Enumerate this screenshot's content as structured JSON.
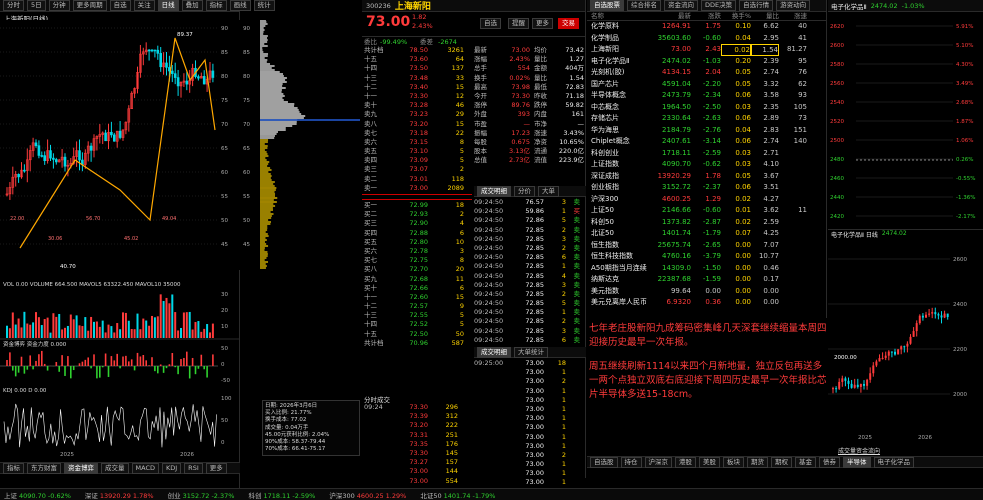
{
  "left_chart": {
    "toolbar_tabs": [
      "分时",
      "5日",
      "分钟",
      "更多周期",
      "自选",
      "关注",
      "日线",
      "叠加",
      "指标",
      "画线",
      "统计"
    ],
    "active_tab": "日线",
    "title": "上海新阳(日线)",
    "price_high": "89.37",
    "price_low": "40.70",
    "price_axis": [
      "90",
      "85",
      "80",
      "75",
      "70",
      "65",
      "60",
      "55",
      "50",
      "45"
    ],
    "hover_values": [
      "22.00",
      "30.06",
      "56.70",
      "45.02",
      "49.04"
    ],
    "vol_label": "VOL 0.00  VOLUME 664.500  MAVOL5 63322.450  MAVOL10 35000",
    "vol_axis": [
      "30",
      "20",
      "10"
    ],
    "macd_label": "资金博弈 资金力度 0.000",
    "macd_axis": [
      "50",
      "0",
      "-50"
    ],
    "kdj_label": "KDJ 0.00  D 0.00",
    "kdj_axis": [
      "100",
      "50",
      "0"
    ],
    "x_labels": [
      "2025",
      "2026"
    ],
    "bottom_tabs": [
      "指标",
      "东方财富",
      "资金博弈",
      "成交量",
      "MACD",
      "KDJ",
      "RSI",
      "更多"
    ],
    "active_bottom_tab": "资金博弈"
  },
  "quote": {
    "code": "300236",
    "name": "上海新阳",
    "price": "73.00",
    "change": "1.82",
    "change_pct": "2.43%",
    "buttons": [
      "自选",
      "提醒",
      "更多",
      "交易"
    ],
    "ratio_label": "委比",
    "ratio_value": "-99.49%",
    "diff_label": "委差",
    "diff_value": "-2674",
    "open_auction": "开盘竞价",
    "sells": [
      {
        "label": "十五",
        "price": "73.60",
        "vol": "64"
      },
      {
        "label": "十四",
        "price": "73.50",
        "vol": "137"
      },
      {
        "label": "十三",
        "price": "73.48",
        "vol": "33"
      },
      {
        "label": "十二",
        "price": "73.40",
        "vol": "15"
      },
      {
        "label": "十一",
        "price": "73.30",
        "vol": "12"
      },
      {
        "label": "卖十",
        "price": "73.28",
        "vol": "46"
      },
      {
        "label": "卖九",
        "price": "73.23",
        "vol": "29"
      },
      {
        "label": "卖八",
        "price": "73.20",
        "vol": "15"
      },
      {
        "label": "卖七",
        "price": "73.18",
        "vol": "22"
      },
      {
        "label": "卖六",
        "price": "73.15",
        "vol": "8"
      },
      {
        "label": "卖五",
        "price": "73.10",
        "vol": "5"
      },
      {
        "label": "卖四",
        "price": "73.09",
        "vol": "5"
      },
      {
        "label": "卖三",
        "price": "73.07",
        "vol": "2"
      },
      {
        "label": "卖二",
        "price": "73.01",
        "vol": "118"
      },
      {
        "label": "卖一",
        "price": "73.00",
        "vol": "2089"
      }
    ],
    "sell_total": {
      "label": "共计档",
      "price": "78.50",
      "vol": "3261"
    },
    "buys": [
      {
        "label": "买一",
        "price": "72.99",
        "vol": "18"
      },
      {
        "label": "买二",
        "price": "72.93",
        "vol": "2"
      },
      {
        "label": "买三",
        "price": "72.90",
        "vol": "4"
      },
      {
        "label": "买四",
        "price": "72.88",
        "vol": "6"
      },
      {
        "label": "买五",
        "price": "72.80",
        "vol": "10"
      },
      {
        "label": "买六",
        "price": "72.78",
        "vol": "3"
      },
      {
        "label": "买七",
        "price": "72.75",
        "vol": "8"
      },
      {
        "label": "买八",
        "price": "72.70",
        "vol": "20"
      },
      {
        "label": "买九",
        "price": "72.68",
        "vol": "11"
      },
      {
        "label": "买十",
        "price": "72.66",
        "vol": "6"
      },
      {
        "label": "十一",
        "price": "72.60",
        "vol": "15"
      },
      {
        "label": "十二",
        "price": "72.57",
        "vol": "9"
      },
      {
        "label": "十三",
        "price": "72.55",
        "vol": "5"
      },
      {
        "label": "十四",
        "price": "72.52",
        "vol": "5"
      },
      {
        "label": "十五",
        "price": "72.50",
        "vol": "50"
      }
    ],
    "buy_total": {
      "label": "共计档",
      "price": "70.96",
      "vol": "587"
    },
    "stats": [
      {
        "k": "最新",
        "v": "73.00",
        "k2": "均价",
        "v2": "73.42"
      },
      {
        "k": "涨幅",
        "v": "2.43%",
        "k2": "量比",
        "v2": "1.27"
      },
      {
        "k": "总手",
        "v": "554",
        "k2": "金额",
        "v2": "404万"
      },
      {
        "k": "换手",
        "v": "0.02%",
        "k2": "量比",
        "v2": "1.54"
      },
      {
        "k": "最高",
        "v": "73.98",
        "k2": "最低",
        "v2": "72.83"
      },
      {
        "k": "今开",
        "v": "73.30",
        "k2": "昨收",
        "v2": "71.18"
      },
      {
        "k": "涨停",
        "v": "89.76",
        "k2": "跌停",
        "v2": "59.82"
      },
      {
        "k": "外盘",
        "v": "393",
        "k2": "内盘",
        "v2": "161"
      },
      {
        "k": "市盈",
        "v": "—",
        "k2": "市净",
        "v2": "—"
      },
      {
        "k": "振幅",
        "v": "17.23",
        "k2": "涨速",
        "v2": "3.43%"
      },
      {
        "k": "每股",
        "v": "0.675",
        "k2": "净资",
        "v2": "10.65%"
      },
      {
        "k": "股本",
        "v": "3.13亿",
        "k2": "流通",
        "v2": "220.0亿"
      },
      {
        "k": "总值",
        "v": "2.73亿",
        "k2": "流值",
        "v2": "223.9亿"
      }
    ],
    "trades_tabs": [
      "成交明细",
      "分价",
      "大单"
    ],
    "trades": [
      {
        "t": "09:24:50",
        "p": "76.57",
        "v": "3",
        "d": "卖"
      },
      {
        "t": "09:24:50",
        "p": "59.86",
        "v": "1",
        "d": "买"
      },
      {
        "t": "09:24:50",
        "p": "72.86",
        "v": "5",
        "d": "卖"
      },
      {
        "t": "09:24:50",
        "p": "72.85",
        "v": "2",
        "d": "卖"
      },
      {
        "t": "09:24:50",
        "p": "72.85",
        "v": "3",
        "d": "卖"
      },
      {
        "t": "09:24:50",
        "p": "72.85",
        "v": "2",
        "d": "卖"
      },
      {
        "t": "09:24:50",
        "p": "72.85",
        "v": "6",
        "d": "卖"
      },
      {
        "t": "09:24:50",
        "p": "72.85",
        "v": "1",
        "d": "卖"
      },
      {
        "t": "09:24:50",
        "p": "72.85",
        "v": "4",
        "d": "卖"
      },
      {
        "t": "09:24:50",
        "p": "72.85",
        "v": "3",
        "d": "卖"
      },
      {
        "t": "09:24:50",
        "p": "72.85",
        "v": "2",
        "d": "卖"
      },
      {
        "t": "09:24:50",
        "p": "72.85",
        "v": "5",
        "d": "卖"
      },
      {
        "t": "09:24:50",
        "p": "72.85",
        "v": "1",
        "d": "卖"
      },
      {
        "t": "09:24:50",
        "p": "72.85",
        "v": "2",
        "d": "卖"
      },
      {
        "t": "09:24:50",
        "p": "72.85",
        "v": "3",
        "d": "卖"
      },
      {
        "t": "09:24:50",
        "p": "72.85",
        "v": "6",
        "d": "卖"
      },
      {
        "t": "09:24:50",
        "p": "72.85",
        "v": "1",
        "d": "卖"
      },
      {
        "t": "09:24:50",
        "p": "72.85",
        "v": "2",
        "d": "卖"
      },
      {
        "t": "09:24:50",
        "p": "72.85",
        "v": "4",
        "d": "卖"
      },
      {
        "t": "09:24:50",
        "p": "72.85",
        "v": "8",
        "d": "卖"
      }
    ],
    "lower_tabs": [
      "成交明细",
      "大单统计"
    ],
    "lower_trades": [
      {
        "t": "09:25:00",
        "p": "73.00",
        "v": "18"
      },
      {
        "t": "",
        "p": "73.00",
        "v": "1"
      },
      {
        "t": "",
        "p": "73.00",
        "v": "2"
      },
      {
        "t": "",
        "p": "73.00",
        "v": "1"
      },
      {
        "t": "",
        "p": "73.00",
        "v": "1"
      },
      {
        "t": "",
        "p": "73.00",
        "v": "1"
      },
      {
        "t": "",
        "p": "73.00",
        "v": "1"
      },
      {
        "t": "",
        "p": "73.00",
        "v": "1"
      },
      {
        "t": "",
        "p": "73.00",
        "v": "1"
      },
      {
        "t": "",
        "p": "73.00",
        "v": "1"
      },
      {
        "t": "",
        "p": "73.00",
        "v": "2"
      },
      {
        "t": "",
        "p": "73.00",
        "v": "1"
      },
      {
        "t": "",
        "p": "73.00",
        "v": "1"
      },
      {
        "t": "",
        "p": "73.00",
        "v": "1"
      },
      {
        "t": "",
        "p": "73.00",
        "v": "1"
      }
    ],
    "minute_header": "分时成交",
    "minute_trades": [
      {
        "t": "09:24",
        "p": "73.30",
        "v": "296"
      },
      {
        "t": "",
        "p": "73.39",
        "v": "312"
      },
      {
        "t": "",
        "p": "73.20",
        "v": "222"
      },
      {
        "t": "",
        "p": "73.31",
        "v": "251"
      },
      {
        "t": "",
        "p": "73.35",
        "v": "176"
      },
      {
        "t": "",
        "p": "73.30",
        "v": "145"
      },
      {
        "t": "",
        "p": "73.27",
        "v": "157"
      },
      {
        "t": "",
        "p": "73.00",
        "v": "144"
      },
      {
        "t": "",
        "p": "73.00",
        "v": "554"
      }
    ],
    "info_lines": [
      "日期: 2026年3月6日",
      "买入比例: 21.77%",
      "换手成本: 77.02",
      "成交量: 0.04万手",
      "45.00元获利比例: 2.04%",
      "90%成本: 58.37-79.44",
      "70%成本: 66.41-75.17"
    ]
  },
  "watchlist": {
    "tabs": [
      "自选股票",
      "综合排名",
      "资金流向",
      "DDE决策",
      "自选行情",
      "游资动向"
    ],
    "headers": [
      "名称",
      "最新",
      "涨跌",
      "换手%",
      "量比",
      "涨速"
    ],
    "rows": [
      {
        "n": "化学原料",
        "p": "1264.91",
        "c": "1.75",
        "t": "0.10",
        "r": "6.62",
        "s": "40"
      },
      {
        "n": "化学制品",
        "p": "35603.60",
        "c": "-0.60",
        "t": "0.04",
        "r": "2.95",
        "s": "41"
      },
      {
        "n": "上海新阳",
        "p": "73.00",
        "c": "2.43",
        "t": "0.02",
        "r": "1.54",
        "s": "81.27"
      },
      {
        "n": "电子化学品Ⅱ",
        "p": "2474.02",
        "c": "-1.03",
        "t": "0.20",
        "r": "2.39",
        "s": "95"
      },
      {
        "n": "光刻机(胶)",
        "p": "4134.15",
        "c": "2.04",
        "t": "0.05",
        "r": "2.74",
        "s": "76"
      },
      {
        "n": "国产芯片",
        "p": "4591.04",
        "c": "-2.20",
        "t": "0.05",
        "r": "3.32",
        "s": "62"
      },
      {
        "n": "半导体概念",
        "p": "2473.79",
        "c": "-2.34",
        "t": "0.06",
        "r": "3.58",
        "s": "93"
      },
      {
        "n": "中芯概念",
        "p": "1964.50",
        "c": "-2.50",
        "t": "0.03",
        "r": "2.35",
        "s": "105"
      },
      {
        "n": "存储芯片",
        "p": "2330.64",
        "c": "-2.63",
        "t": "0.06",
        "r": "2.89",
        "s": "73"
      },
      {
        "n": "华为海思",
        "p": "2184.79",
        "c": "-2.76",
        "t": "0.04",
        "r": "2.83",
        "s": "151"
      },
      {
        "n": "Chiplet概念",
        "p": "2407.61",
        "c": "-3.14",
        "t": "0.06",
        "r": "2.74",
        "s": "140"
      },
      {
        "n": "科创创业",
        "p": "1718.11",
        "c": "-2.59",
        "t": "0.03",
        "r": "2.71",
        "s": ""
      },
      {
        "n": "上证指数",
        "p": "4090.70",
        "c": "-0.62",
        "t": "0.03",
        "r": "4.10",
        "s": ""
      },
      {
        "n": "深证成指",
        "p": "13920.29",
        "c": "1.78",
        "t": "0.05",
        "r": "3.67",
        "s": ""
      },
      {
        "n": "创业板指",
        "p": "3152.72",
        "c": "-2.37",
        "t": "0.06",
        "r": "3.51",
        "s": ""
      },
      {
        "n": "沪深300",
        "p": "4600.25",
        "c": "1.29",
        "t": "0.02",
        "r": "4.27",
        "s": ""
      },
      {
        "n": "上证50",
        "p": "2146.66",
        "c": "-0.60",
        "t": "0.01",
        "r": "3.62",
        "s": "11"
      },
      {
        "n": "科创50",
        "p": "1373.82",
        "c": "-2.87",
        "t": "0.02",
        "r": "2.59",
        "s": ""
      },
      {
        "n": "北证50",
        "p": "1401.74",
        "c": "-1.79",
        "t": "0.07",
        "r": "4.25",
        "s": ""
      },
      {
        "n": "恒生指数",
        "p": "25675.74",
        "c": "-2.65",
        "t": "0.00",
        "r": "7.07",
        "s": ""
      },
      {
        "n": "恒生科技指数",
        "p": "4760.16",
        "c": "-3.79",
        "t": "0.00",
        "r": "10.77",
        "s": ""
      },
      {
        "n": "A50期指当月连续",
        "p": "14309.0",
        "c": "-1.50",
        "t": "0.00",
        "r": "0.46",
        "s": ""
      },
      {
        "n": "纳斯达克",
        "p": "22387.68",
        "c": "-1.59",
        "t": "0.00",
        "r": "0.17",
        "s": ""
      },
      {
        "n": "美元指数",
        "p": "99.64",
        "c": "0.00",
        "t": "0.00",
        "r": "0.00",
        "s": ""
      },
      {
        "n": "美元兑离岸人民币",
        "p": "6.9320",
        "c": "0.36",
        "t": "0.00",
        "r": "0.00",
        "s": ""
      }
    ],
    "bottom_tabs": [
      "自选股",
      "持仓",
      "沪深京",
      "港股",
      "美股",
      "板块",
      "期货",
      "期权",
      "基金",
      "债券",
      "半导体",
      "电子化学品"
    ],
    "active_bottom_tab": "半导体"
  },
  "notes": {
    "para1": "七年老庄股新阳九成筹码密集峰几天深套继续缩量本周四迎接历史最早一次年报。",
    "para2": "周五继续刷新1114以来四个月新地量，独立反包再送多一两个点独立双底右底迎接下周四历史最早一次年报比芯片半导体多送15-18cm。"
  },
  "side_chart": {
    "title": "电子化学品Ⅱ",
    "price": "2474.02",
    "pct": "-1.03%",
    "ladder": [
      "2620",
      "2600",
      "2580",
      "2560",
      "2540",
      "2520",
      "2500",
      "2480",
      "2460",
      "2440",
      "2420"
    ],
    "ladder_pct": [
      "5.91%",
      "5.10%",
      "4.30%",
      "3.49%",
      "2.68%",
      "1.87%",
      "1.06%",
      "0.26%",
      "-0.55%",
      "-1.36%",
      "-2.17%"
    ],
    "mini_title": "电子化学品Ⅱ 日线",
    "mini_price": "2474.02",
    "mini_axis": [
      "2600",
      "2400",
      "2200",
      "2000"
    ],
    "mini_low": "2000.00",
    "mini_x": [
      "2025",
      "2026"
    ],
    "link": "成交量资金流向"
  },
  "status_bar": {
    "items": [
      {
        "k": "上证",
        "v": "4090.70",
        "c": "-0.62%"
      },
      {
        "k": "深证",
        "v": "13920.29",
        "c": "1.78%"
      },
      {
        "k": "创业",
        "v": "3152.72",
        "c": "-2.37%"
      },
      {
        "k": "科创",
        "v": "1718.11",
        "c": "-2.59%"
      },
      {
        "k": "沪深300",
        "v": "4600.25",
        "c": "1.29%"
      },
      {
        "k": "北证50",
        "v": "1401.74",
        "c": "-1.79%"
      }
    ]
  }
}
